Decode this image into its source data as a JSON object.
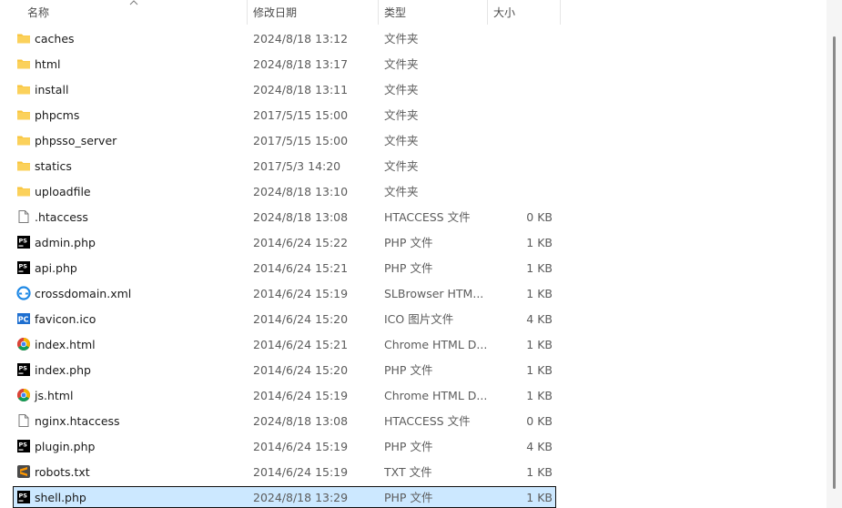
{
  "header": {
    "name_label": "名称",
    "date_label": "修改日期",
    "type_label": "类型",
    "size_label": "大小"
  },
  "files": [
    {
      "name": "caches",
      "date": "2024/8/18 13:12",
      "type": "文件夹",
      "size": "",
      "icon": "folder-icon"
    },
    {
      "name": "html",
      "date": "2024/8/18 13:17",
      "type": "文件夹",
      "size": "",
      "icon": "folder-icon"
    },
    {
      "name": "install",
      "date": "2024/8/18 13:11",
      "type": "文件夹",
      "size": "",
      "icon": "folder-icon"
    },
    {
      "name": "phpcms",
      "date": "2017/5/15 15:00",
      "type": "文件夹",
      "size": "",
      "icon": "folder-icon"
    },
    {
      "name": "phpsso_server",
      "date": "2017/5/15 15:00",
      "type": "文件夹",
      "size": "",
      "icon": "folder-icon"
    },
    {
      "name": "statics",
      "date": "2017/5/3 14:20",
      "type": "文件夹",
      "size": "",
      "icon": "folder-icon"
    },
    {
      "name": "uploadfile",
      "date": "2024/8/18 13:10",
      "type": "文件夹",
      "size": "",
      "icon": "folder-icon"
    },
    {
      "name": ".htaccess",
      "date": "2024/8/18 13:08",
      "type": "HTACCESS 文件",
      "size": "0 KB",
      "icon": "blank-file-icon"
    },
    {
      "name": "admin.php",
      "date": "2014/6/24 15:22",
      "type": "PHP 文件",
      "size": "1 KB",
      "icon": "phpstorm-icon"
    },
    {
      "name": "api.php",
      "date": "2014/6/24 15:21",
      "type": "PHP 文件",
      "size": "1 KB",
      "icon": "phpstorm-icon"
    },
    {
      "name": "crossdomain.xml",
      "date": "2014/6/24 15:19",
      "type": "SLBrowser HTM...",
      "size": "1 KB",
      "icon": "slbrowser-icon"
    },
    {
      "name": "favicon.ico",
      "date": "2014/6/24 15:20",
      "type": "ICO 图片文件",
      "size": "4 KB",
      "icon": "ico-image-icon"
    },
    {
      "name": "index.html",
      "date": "2014/6/24 15:21",
      "type": "Chrome HTML D...",
      "size": "1 KB",
      "icon": "chrome-icon"
    },
    {
      "name": "index.php",
      "date": "2014/6/24 15:20",
      "type": "PHP 文件",
      "size": "1 KB",
      "icon": "phpstorm-icon"
    },
    {
      "name": "js.html",
      "date": "2014/6/24 15:19",
      "type": "Chrome HTML D...",
      "size": "1 KB",
      "icon": "chrome-icon"
    },
    {
      "name": "nginx.htaccess",
      "date": "2024/8/18 13:08",
      "type": "HTACCESS 文件",
      "size": "0 KB",
      "icon": "blank-file-icon"
    },
    {
      "name": "plugin.php",
      "date": "2014/6/24 15:19",
      "type": "PHP 文件",
      "size": "4 KB",
      "icon": "phpstorm-icon"
    },
    {
      "name": "robots.txt",
      "date": "2014/6/24 15:19",
      "type": "TXT 文件",
      "size": "1 KB",
      "icon": "sublime-icon"
    },
    {
      "name": "shell.php",
      "date": "2024/8/18 13:29",
      "type": "PHP 文件",
      "size": "1 KB",
      "icon": "phpstorm-icon",
      "selected": true
    }
  ],
  "colors": {
    "selection_bg": "#cce8ff",
    "folder": "#f8c33a",
    "phpstorm_bg": "#000000"
  }
}
